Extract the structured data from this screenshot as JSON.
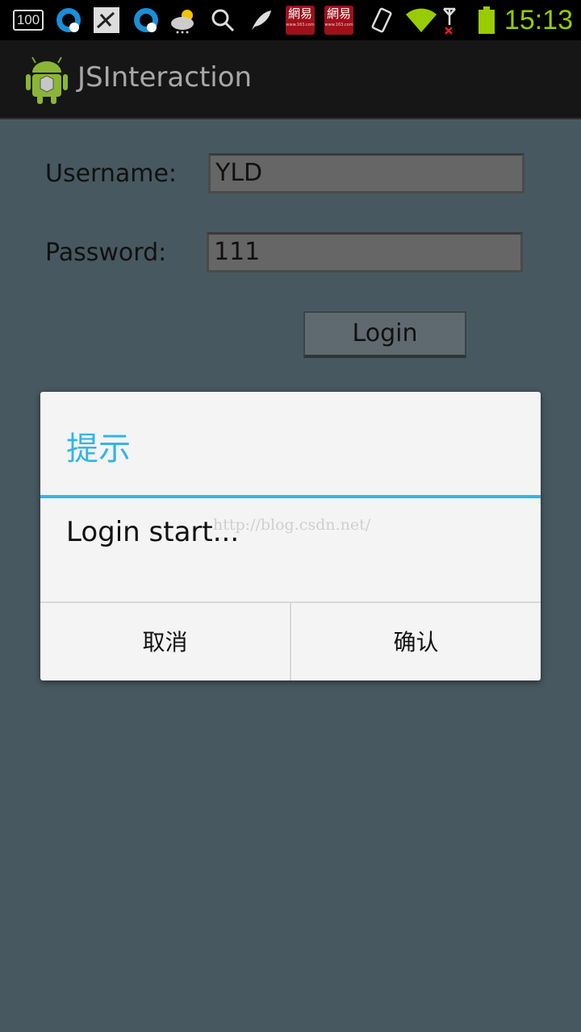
{
  "status_bar": {
    "notification_badge": "100",
    "time": "15:13",
    "icons": [
      "notification-100-icon",
      "qq-icon",
      "task-icon",
      "qq-icon",
      "weather-icon",
      "search-icon",
      "feather-icon",
      "netease-icon",
      "netease-icon",
      "vibrate-icon",
      "wifi-icon",
      "signal-icon",
      "battery-icon"
    ],
    "netease_label": "網易",
    "netease_sublabel": "www.163.com"
  },
  "action_bar": {
    "title": "JSInteraction"
  },
  "form": {
    "username_label": "Username:",
    "username_value": "YLD",
    "password_label": "Password:",
    "password_value": "111",
    "login_label": "Login"
  },
  "dialog": {
    "title": "提示",
    "message": "Login start...",
    "cancel_label": "取消",
    "ok_label": "确认",
    "accent_color": "#33b5e5"
  },
  "watermark": "http://blog.csdn.net/"
}
